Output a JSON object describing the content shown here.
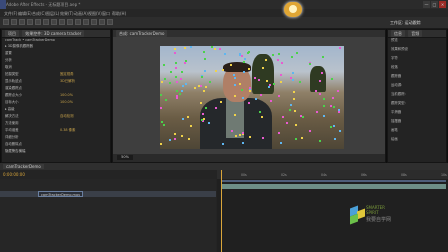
{
  "window": {
    "title": "Adobe After Effects - 无标题项目.aep *",
    "controls": [
      "—",
      "□",
      "✕"
    ]
  },
  "menubar": {
    "items": [
      "文件(F)",
      "编辑(E)",
      "合成(C)",
      "图层(L)",
      "效果(T)",
      "动画(A)",
      "视图(V)",
      "窗口",
      "帮助(H)"
    ]
  },
  "toolbar": {
    "workspace": "工作区: 运动跟踪"
  },
  "left_panel": {
    "tabs": [
      "项目",
      "效果控件: 3D camera tracker"
    ],
    "breadcrumb": "camTrack • camTrackerDemo",
    "rows": [
      {
        "label": "▸ 3D摄像机跟踪器",
        "value": ""
      },
      {
        "label": "  重置",
        "value": ""
      },
      {
        "label": "  分析",
        "value": ""
      },
      {
        "label": "  取消",
        "value": ""
      },
      {
        "label": "  拍摄类型",
        "value": "固定视角"
      },
      {
        "label": "  显示轨迹点",
        "value": "3D已解析"
      },
      {
        "label": "  渲染跟踪点",
        "value": ""
      },
      {
        "label": "  跟踪点大小",
        "value": "100.0%"
      },
      {
        "label": "  目标大小",
        "value": "100.0%"
      },
      {
        "label": "▸ 高级",
        "value": ""
      },
      {
        "label": "  解决方法",
        "value": "自动检测"
      },
      {
        "label": "  方法使用",
        "value": ""
      },
      {
        "label": "  平均误差",
        "value": "0.38 像素"
      },
      {
        "label": "  详细分析",
        "value": ""
      },
      {
        "label": "  自动删除点",
        "value": ""
      },
      {
        "label": "  隐藏警告横幅",
        "value": ""
      }
    ]
  },
  "viewer": {
    "tab": "合成: camTrackerDemo",
    "zoom": "50%"
  },
  "right_panel": {
    "tabs": [
      "信息",
      "音频"
    ],
    "rows": [
      "预览",
      "效果和预设",
      "字符",
      "段落",
      "跟踪器",
      "运动源:",
      "当前跟踪:",
      "跟踪类型:",
      "平滑器",
      "摇摆器",
      "画笔",
      "绘画"
    ]
  },
  "timeline": {
    "tab": "camTrackerDemo",
    "timecode": "0:00:00:00",
    "layer_name": "camTrackerDemo.mov",
    "ruler_ticks": [
      "00s",
      "02s",
      "04s",
      "06s",
      "08s",
      "10s"
    ]
  },
  "watermark": {
    "line1": "SMARTER",
    "line2": "SPIRIT",
    "line3": "我要自学网"
  },
  "colors": {
    "accent": "#d9a53a",
    "layer_bar": "#6e8f87",
    "track_point_colors": [
      "#e85bd0",
      "#4bd24b",
      "#f0d24a",
      "#5fb6f0"
    ]
  }
}
